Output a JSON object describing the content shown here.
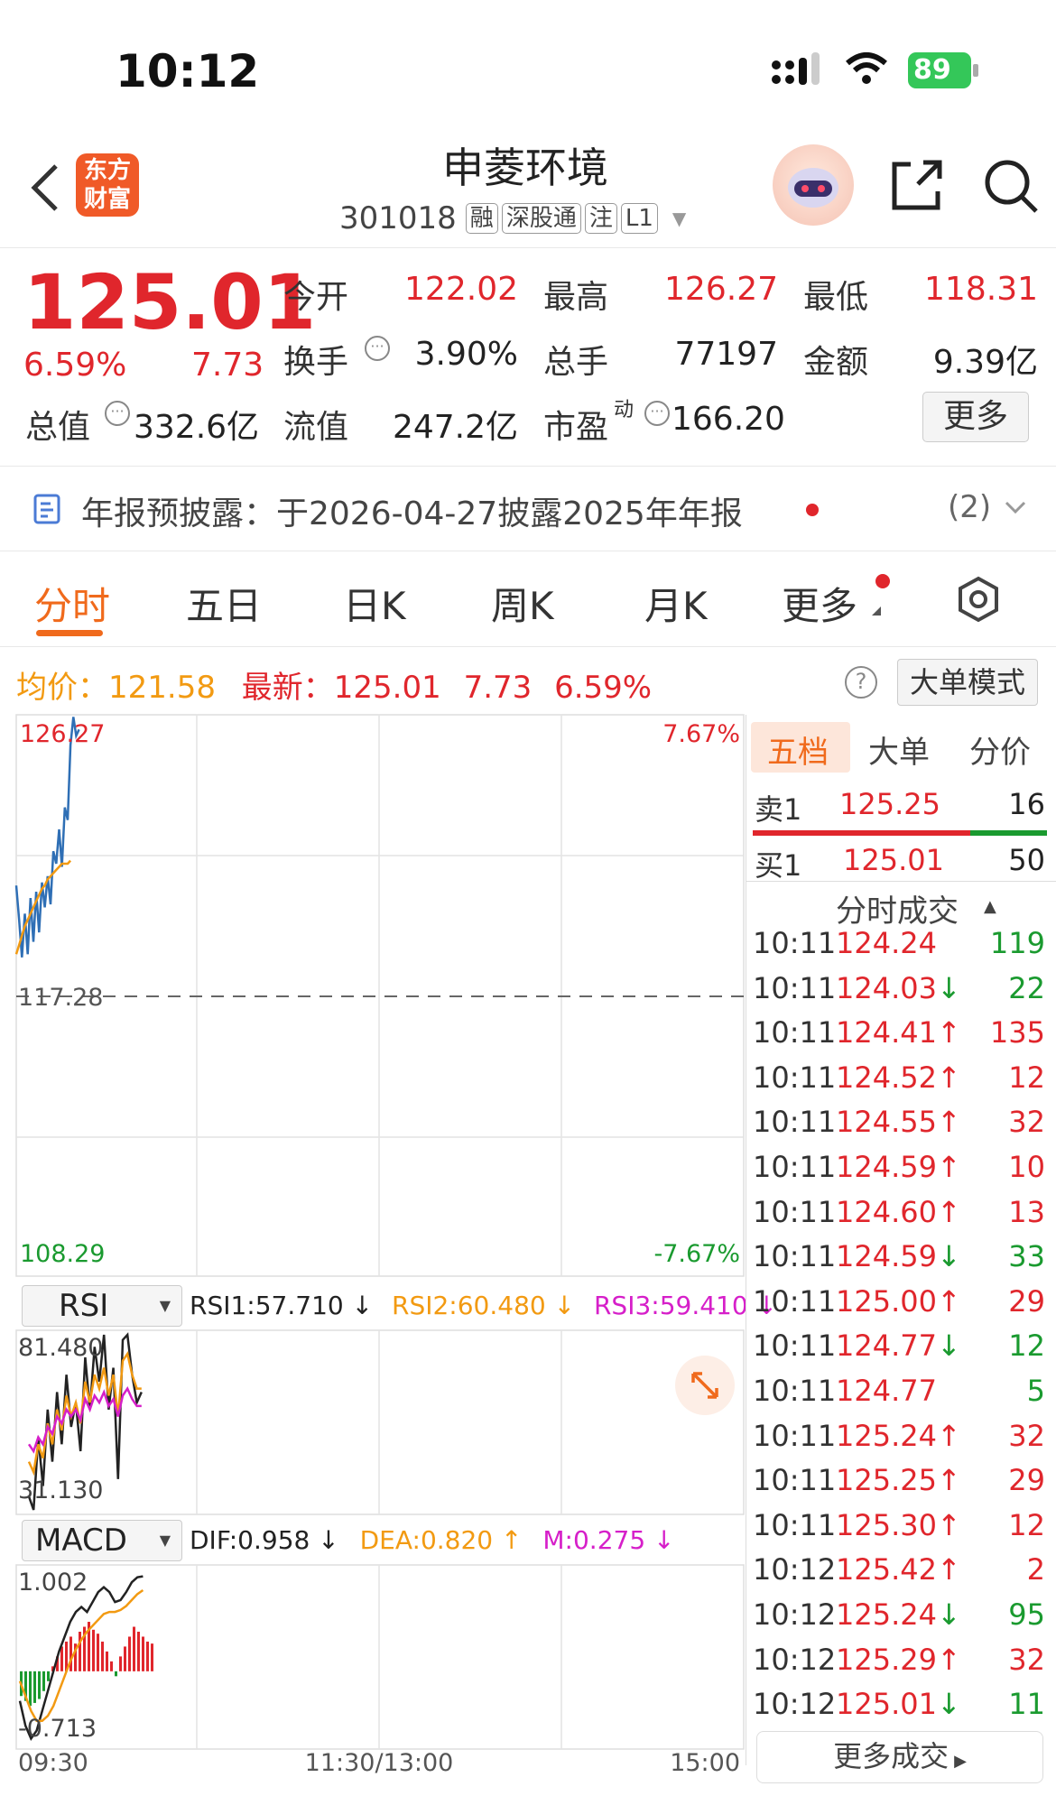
{
  "status_bar": {
    "time": "10:12",
    "battery": "89"
  },
  "header": {
    "logo_text": "东方财富",
    "stock_name": "申菱环境",
    "stock_code": "301018",
    "tags": [
      "融",
      "深股通",
      "注",
      "L1"
    ]
  },
  "quote": {
    "price": "125.01",
    "change_pct": "6.59%",
    "change": "7.73",
    "open_label": "今开",
    "open": "122.02",
    "high_label": "最高",
    "high": "126.27",
    "low_label": "最低",
    "low": "118.31",
    "turnover_label": "换手",
    "turnover": "3.90%",
    "volume_label": "总手",
    "volume": "77197",
    "amount_label": "金额",
    "amount": "9.39亿",
    "mktcap_label": "总值",
    "mktcap": "332.6亿",
    "float_label": "流值",
    "float": "247.2亿",
    "pe_label": "市盈",
    "pe_sup": "动",
    "pe": "166.20",
    "more_button": "更多"
  },
  "notice": {
    "text": "年报预披露：于2026-04-27披露2025年年报",
    "count": "(2)"
  },
  "tabs": [
    "分时",
    "五日",
    "日K",
    "周K",
    "月K",
    "更多"
  ],
  "chart_info": {
    "avg_label": "均价：",
    "avg": "121.58",
    "latest_label": "最新：",
    "latest": "125.01",
    "latest_change": "7.73",
    "latest_pct": "6.59%",
    "mode_button": "大单模式"
  },
  "chart_data": [
    {
      "type": "line",
      "title": "",
      "y_top_label": "126.27",
      "y_mid_label": "117.28",
      "y_bottom_label": "108.29",
      "pct_top_label": "7.67%",
      "pct_bottom_label": "-7.67%",
      "x_labels": [
        "09:30",
        "11:30/13:00",
        "15:00"
      ],
      "ylim": [
        108.29,
        126.27
      ],
      "series": [
        {
          "values": [
            120.8,
            119.7,
            118.5,
            119.9,
            118.6,
            120.4,
            119.0,
            120.6,
            119.3,
            120.9,
            120.1,
            121.1,
            120.2,
            121.9,
            121.5,
            122.6,
            121.4,
            123.3,
            122.9,
            125.3,
            126.2,
            125.6,
            125.8
          ],
          "color": "#2f6fb5"
        },
        {
          "values": [
            118.6,
            118.9,
            119.2,
            119.5,
            119.7,
            119.9,
            120.1,
            120.3,
            120.5,
            120.7,
            120.8,
            121.0,
            121.1,
            121.2,
            121.3,
            121.4,
            121.5,
            121.5,
            121.5,
            121.6
          ],
          "color": "#f29a12"
        }
      ]
    },
    {
      "type": "line",
      "title": "RSI",
      "selector": "RSI",
      "y_top_label": "81.480",
      "y_bottom_label": "31.130",
      "ylim": [
        31.13,
        81.48
      ],
      "legend": [
        {
          "label": "RSI1:57.710 ↓",
          "color": "#222"
        },
        {
          "label": "RSI2:60.480 ↓",
          "color": "#f29a12"
        },
        {
          "label": "RSI3:59.410 ↓",
          "color": "#d61fc9"
        }
      ],
      "series": [
        {
          "values": [
            35,
            30,
            52,
            38,
            60,
            45,
            65,
            50,
            70,
            55,
            62,
            48,
            75,
            60,
            78,
            68,
            82,
            60,
            72,
            40,
            80,
            85,
            70,
            62,
            65
          ],
          "color": "#222"
        },
        {
          "values": [
            45,
            42,
            50,
            46,
            56,
            50,
            60,
            54,
            64,
            58,
            62,
            56,
            68,
            62,
            70,
            66,
            72,
            64,
            70,
            58,
            74,
            76,
            70,
            66,
            66
          ],
          "color": "#f29a12"
        },
        {
          "values": [
            50,
            48,
            52,
            50,
            55,
            53,
            58,
            56,
            60,
            58,
            60,
            57,
            63,
            60,
            64,
            62,
            65,
            61,
            63,
            58,
            64,
            66,
            63,
            61,
            61
          ],
          "color": "#d61fc9"
        }
      ]
    },
    {
      "type": "bar",
      "title": "MACD",
      "selector": "MACD",
      "y_top_label": "1.002",
      "y_bottom_label": "-0.713",
      "ylim": [
        -0.713,
        1.002
      ],
      "legend": [
        {
          "label": "DIF:0.958 ↓",
          "color": "#222"
        },
        {
          "label": "DEA:0.820 ↑",
          "color": "#f29a12"
        },
        {
          "label": "M:0.275 ↓",
          "color": "#d61fc9"
        }
      ],
      "values": [
        -0.25,
        -0.3,
        -0.35,
        -0.32,
        -0.28,
        -0.2,
        -0.1,
        0.05,
        0.15,
        0.25,
        0.3,
        0.35,
        0.28,
        0.4,
        0.45,
        0.5,
        0.42,
        0.38,
        0.3,
        0.2,
        0.1,
        -0.05,
        0.15,
        0.25,
        0.35,
        0.45,
        0.4,
        0.35,
        0.3,
        0.28
      ],
      "series": [
        {
          "values": [
            -0.3,
            -0.55,
            -0.68,
            -0.6,
            -0.4,
            -0.2,
            0.0,
            0.2,
            0.35,
            0.5,
            0.6,
            0.65,
            0.6,
            0.7,
            0.8,
            0.85,
            0.8,
            0.7,
            0.72,
            0.8,
            0.9,
            0.95,
            0.96
          ],
          "color": "#222"
        },
        {
          "values": [
            -0.1,
            -0.25,
            -0.4,
            -0.5,
            -0.5,
            -0.45,
            -0.35,
            -0.2,
            -0.05,
            0.1,
            0.22,
            0.32,
            0.4,
            0.46,
            0.52,
            0.58,
            0.6,
            0.6,
            0.62,
            0.66,
            0.72,
            0.78,
            0.82
          ],
          "color": "#f29a12"
        }
      ]
    }
  ],
  "side_panel": {
    "tabs": [
      "五档",
      "大单",
      "分价"
    ],
    "sell1_label": "卖1",
    "sell1_price": "125.25",
    "sell1_vol": "16",
    "buy1_label": "买1",
    "buy1_price": "125.01",
    "buy1_vol": "50",
    "trades_header": "分时成交",
    "trades": [
      {
        "time": "10:11",
        "price": "124.24",
        "arrow": "",
        "vol": "119",
        "pc": "red",
        "vc": "green"
      },
      {
        "time": "10:11",
        "price": "124.03",
        "arrow": "↓",
        "vol": "22",
        "pc": "red",
        "vc": "green"
      },
      {
        "time": "10:11",
        "price": "124.41",
        "arrow": "↑",
        "vol": "135",
        "pc": "red",
        "vc": "red"
      },
      {
        "time": "10:11",
        "price": "124.52",
        "arrow": "↑",
        "vol": "12",
        "pc": "red",
        "vc": "red"
      },
      {
        "time": "10:11",
        "price": "124.55",
        "arrow": "↑",
        "vol": "32",
        "pc": "red",
        "vc": "red"
      },
      {
        "time": "10:11",
        "price": "124.59",
        "arrow": "↑",
        "vol": "10",
        "pc": "red",
        "vc": "red"
      },
      {
        "time": "10:11",
        "price": "124.60",
        "arrow": "↑",
        "vol": "13",
        "pc": "red",
        "vc": "red"
      },
      {
        "time": "10:11",
        "price": "124.59",
        "arrow": "↓",
        "vol": "33",
        "pc": "red",
        "vc": "green"
      },
      {
        "time": "10:11",
        "price": "125.00",
        "arrow": "↑",
        "vol": "29",
        "pc": "red",
        "vc": "red"
      },
      {
        "time": "10:11",
        "price": "124.77",
        "arrow": "↓",
        "vol": "12",
        "pc": "red",
        "vc": "green"
      },
      {
        "time": "10:11",
        "price": "124.77",
        "arrow": "",
        "vol": "5",
        "pc": "red",
        "vc": "green"
      },
      {
        "time": "10:11",
        "price": "125.24",
        "arrow": "↑",
        "vol": "32",
        "pc": "red",
        "vc": "red"
      },
      {
        "time": "10:11",
        "price": "125.25",
        "arrow": "↑",
        "vol": "29",
        "pc": "red",
        "vc": "red"
      },
      {
        "time": "10:11",
        "price": "125.30",
        "arrow": "↑",
        "vol": "12",
        "pc": "red",
        "vc": "red"
      },
      {
        "time": "10:12",
        "price": "125.42",
        "arrow": "↑",
        "vol": "2",
        "pc": "red",
        "vc": "red"
      },
      {
        "time": "10:12",
        "price": "125.24",
        "arrow": "↓",
        "vol": "95",
        "pc": "red",
        "vc": "green"
      },
      {
        "time": "10:12",
        "price": "125.29",
        "arrow": "↑",
        "vol": "32",
        "pc": "red",
        "vc": "red"
      },
      {
        "time": "10:12",
        "price": "125.01",
        "arrow": "↓",
        "vol": "11",
        "pc": "red",
        "vc": "green"
      }
    ],
    "more_trades": "更多成交"
  },
  "colors": {
    "up": "#e0262c",
    "down": "#1a9a2f",
    "accent": "#f06a1c",
    "avg": "#f29a12"
  }
}
